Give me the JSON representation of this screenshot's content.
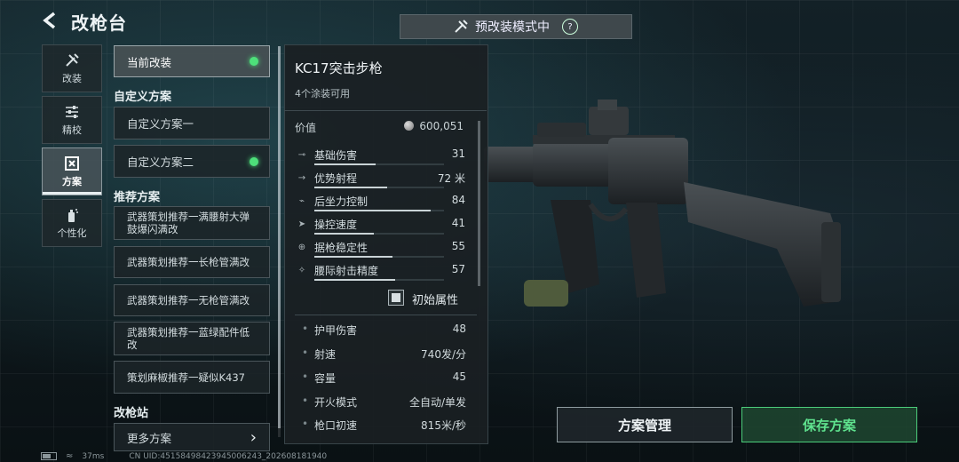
{
  "header": {
    "title": "改枪台",
    "mode_label": "预改装模式中",
    "help_label": "?"
  },
  "tabs": [
    {
      "label": "改装",
      "icon": "wrench-screwdriver-icon"
    },
    {
      "label": "精校",
      "icon": "sliders-icon"
    },
    {
      "label": "方案",
      "icon": "blueprint-icon",
      "active": true
    },
    {
      "label": "个性化",
      "icon": "spray-can-icon"
    }
  ],
  "plans": {
    "current": {
      "label": "当前改装",
      "equipped": true
    },
    "custom_heading": "自定义方案",
    "custom": [
      {
        "label": "自定义方案一",
        "equipped": false
      },
      {
        "label": "自定义方案二",
        "equipped": true
      }
    ],
    "recommended_heading": "推荐方案",
    "recommended": [
      "武器策划推荐一满腰射大弹鼓爆闪满改",
      "武器策划推荐一长枪管满改",
      "武器策划推荐一无枪管满改",
      "武器策划推荐一蓝绿配件低改",
      "策划麻椒推荐一疑似K437"
    ],
    "station_heading": "改枪站",
    "more_label": "更多方案"
  },
  "weapon": {
    "name": "KC17突击步枪",
    "skins_available": "4个涂装可用",
    "value_label": "价值",
    "value": "600,051",
    "stats": [
      {
        "label": "基础伤害",
        "value": "31",
        "level": 0.47,
        "icon": "damage-icon"
      },
      {
        "label": "优势射程",
        "value": "72 米",
        "level": 0.56,
        "icon": "range-icon"
      },
      {
        "label": "后坐力控制",
        "value": "84",
        "level": 0.9,
        "icon": "recoil-icon"
      },
      {
        "label": "操控速度",
        "value": "41",
        "level": 0.46,
        "icon": "handling-icon"
      },
      {
        "label": "据枪稳定性",
        "value": "55",
        "level": 0.6,
        "icon": "stability-icon"
      },
      {
        "label": "腰际射击精度",
        "value": "57",
        "level": 0.62,
        "icon": "hipfire-icon"
      }
    ],
    "base_stats_toggle": "初始属性",
    "properties": [
      {
        "label": "护甲伤害",
        "value": "48"
      },
      {
        "label": "射速",
        "value": "740发/分"
      },
      {
        "label": "容量",
        "value": "45"
      },
      {
        "label": "开火模式",
        "value": "全自动/单发"
      },
      {
        "label": "枪口初速",
        "value": "815米/秒"
      }
    ]
  },
  "actions": {
    "manage_label": "方案管理",
    "save_label": "保存方案"
  },
  "footer": {
    "ping": "37ms",
    "uid": "CN UID:45158498423945006243_202608181940"
  },
  "colors": {
    "accent_green": "#4de07a",
    "save_green": "#5fe28e"
  }
}
